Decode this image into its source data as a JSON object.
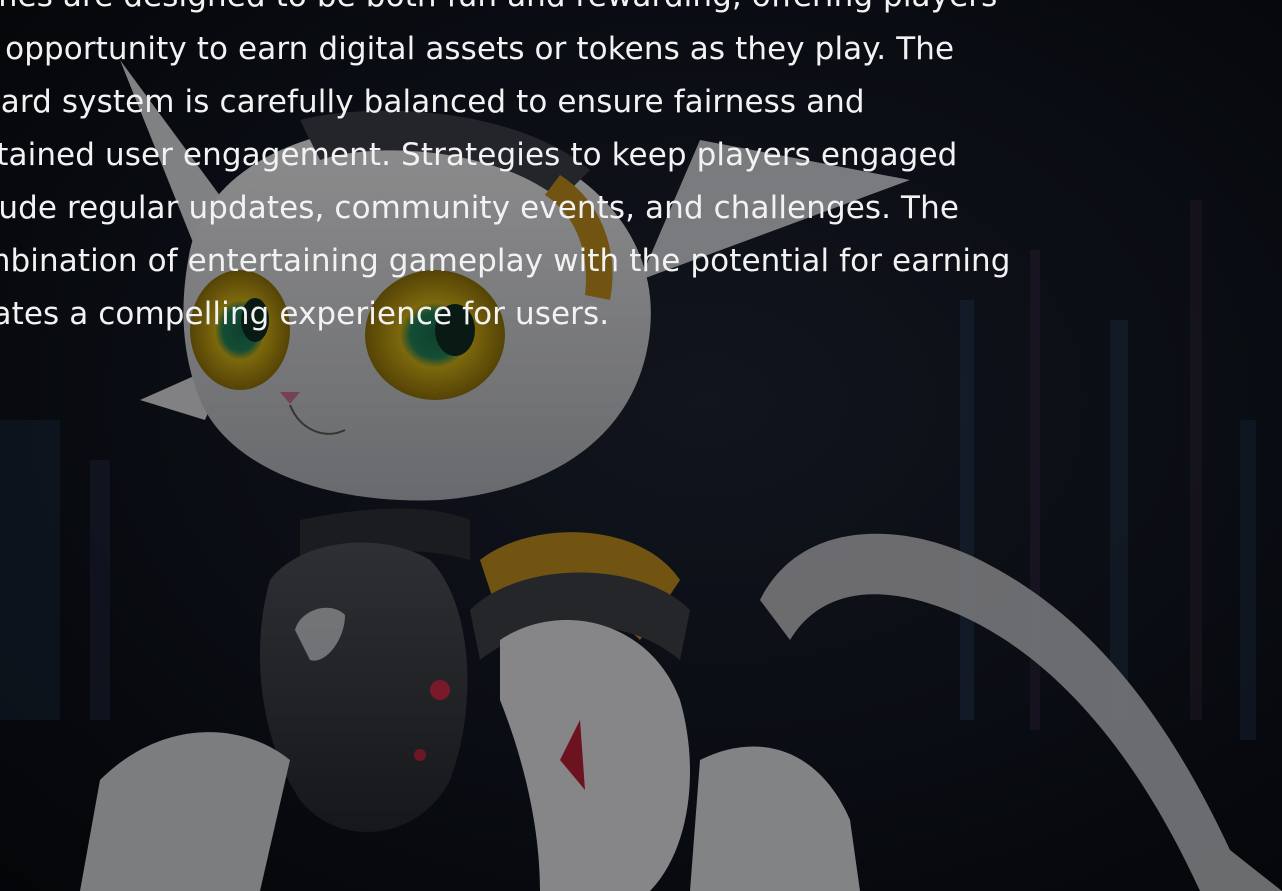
{
  "slide": {
    "lines": [
      "Games are designed to be both fun and rewarding, offering players",
      "the opportunity to earn digital assets or tokens as they play. The",
      "reward system is carefully balanced to ensure fairness and",
      "sustained user engagement. Strategies to keep players engaged",
      "include regular updates, community events, and challenges. The",
      "combination of entertaining gameplay with the potential for earning",
      "creates a compelling experience for users."
    ]
  },
  "colors": {
    "text": "#f2f2f2",
    "background": "#0a0c12",
    "accent_eye": "#d8b21a",
    "accent_armor": "#b7861e"
  }
}
